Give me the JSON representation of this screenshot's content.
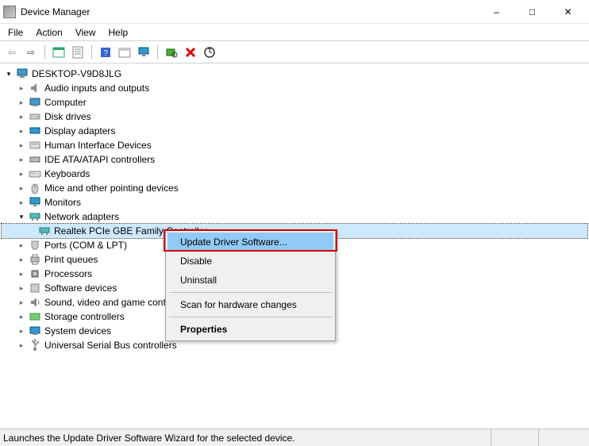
{
  "window": {
    "title": "Device Manager"
  },
  "menu": {
    "file": "File",
    "action": "Action",
    "view": "View",
    "help": "Help"
  },
  "tree": {
    "root": "DESKTOP-V9D8JLG",
    "nodes": [
      {
        "label": "Audio inputs and outputs",
        "expanded": false
      },
      {
        "label": "Computer",
        "expanded": false
      },
      {
        "label": "Disk drives",
        "expanded": false
      },
      {
        "label": "Display adapters",
        "expanded": false
      },
      {
        "label": "Human Interface Devices",
        "expanded": false
      },
      {
        "label": "IDE ATA/ATAPI controllers",
        "expanded": false
      },
      {
        "label": "Keyboards",
        "expanded": false
      },
      {
        "label": "Mice and other pointing devices",
        "expanded": false
      },
      {
        "label": "Monitors",
        "expanded": false
      },
      {
        "label": "Network adapters",
        "expanded": true,
        "children": [
          {
            "label": "Realtek PCIe GBE Family Controller",
            "selected": true
          }
        ]
      },
      {
        "label": "Ports (COM & LPT)",
        "expanded": false
      },
      {
        "label": "Print queues",
        "expanded": false
      },
      {
        "label": "Processors",
        "expanded": false
      },
      {
        "label": "Software devices",
        "expanded": false
      },
      {
        "label": "Sound, video and game controllers",
        "truncated": "Sound, video and game cont",
        "expanded": false
      },
      {
        "label": "Storage controllers",
        "expanded": false
      },
      {
        "label": "System devices",
        "expanded": false
      },
      {
        "label": "Universal Serial Bus controllers",
        "expanded": false
      }
    ]
  },
  "context_menu": {
    "update": "Update Driver Software...",
    "disable": "Disable",
    "uninstall": "Uninstall",
    "scan": "Scan for hardware changes",
    "properties": "Properties"
  },
  "status": "Launches the Update Driver Software Wizard for the selected device."
}
